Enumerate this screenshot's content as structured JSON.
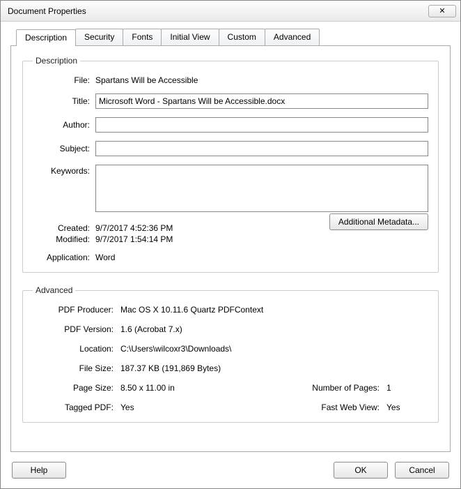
{
  "window": {
    "title": "Document Properties"
  },
  "tabs": {
    "description": "Description",
    "security": "Security",
    "fonts": "Fonts",
    "initial_view": "Initial View",
    "custom": "Custom",
    "advanced": "Advanced"
  },
  "description_group": {
    "legend": "Description",
    "file_label": "File:",
    "file_value": "Spartans Will be Accessible",
    "title_label": "Title:",
    "title_value": "Microsoft Word - Spartans Will be Accessible.docx",
    "author_label": "Author:",
    "author_value": "",
    "subject_label": "Subject:",
    "subject_value": "",
    "keywords_label": "Keywords:",
    "keywords_value": "",
    "created_label": "Created:",
    "created_value": "9/7/2017 4:52:36 PM",
    "modified_label": "Modified:",
    "modified_value": "9/7/2017 1:54:14 PM",
    "application_label": "Application:",
    "application_value": "Word",
    "additional_metadata": "Additional Metadata..."
  },
  "advanced_group": {
    "legend": "Advanced",
    "producer_label": "PDF Producer:",
    "producer_value": "Mac OS X 10.11.6 Quartz PDFContext",
    "version_label": "PDF Version:",
    "version_value": "1.6 (Acrobat 7.x)",
    "location_label": "Location:",
    "location_value": "C:\\Users\\wilcoxr3\\Downloads\\",
    "filesize_label": "File Size:",
    "filesize_value": "187.37 KB (191,869 Bytes)",
    "pagesize_label": "Page Size:",
    "pagesize_value": "8.50 x 11.00 in",
    "numpages_label": "Number of Pages:",
    "numpages_value": "1",
    "tagged_label": "Tagged PDF:",
    "tagged_value": "Yes",
    "fastweb_label": "Fast Web View:",
    "fastweb_value": "Yes"
  },
  "buttons": {
    "help": "Help",
    "ok": "OK",
    "cancel": "Cancel"
  }
}
